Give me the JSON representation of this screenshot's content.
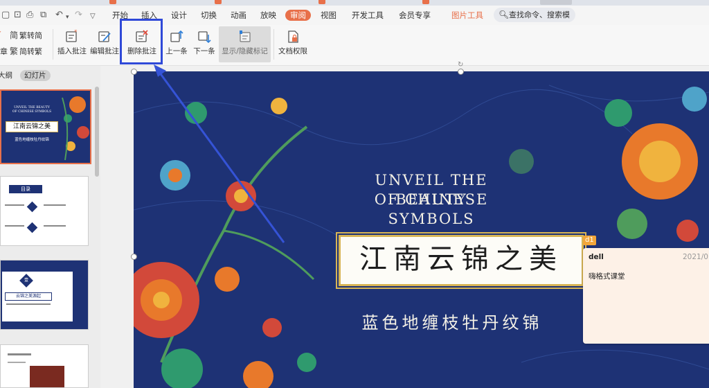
{
  "colors": {
    "accent": "#e8704a",
    "highlight": "#2f49d8",
    "slide_bg": "#1e3275",
    "gold": "#d8b554"
  },
  "quick_access": {
    "icons": [
      "save-icon",
      "print-preview-icon",
      "print-icon",
      "preview-icon",
      "undo-icon",
      "dropdown-arrow-icon",
      "redo-icon",
      "customize-icon"
    ]
  },
  "menu": {
    "items": [
      "开始",
      "插入",
      "设计",
      "切换",
      "动画",
      "放映",
      "审阅",
      "视图",
      "开发工具",
      "会员专享",
      "图片工具"
    ],
    "active": "审阅"
  },
  "search": {
    "text": "查找命令、搜索模板"
  },
  "ribbon": {
    "trad_to_simp": "繁转简",
    "simp_to_trad": "简转繁",
    "insert_comment": "插入批注",
    "edit_comment": "编辑批注",
    "delete_comment": "删除批注",
    "prev": "上一条",
    "next": "下一条",
    "show_hide_markup": "显示/隐藏标记",
    "doc_permissions": "文档权限"
  },
  "left_panel": {
    "tabs": [
      "大纲",
      "幻灯片"
    ],
    "selected_tab": "幻灯片",
    "thumb1": {
      "line1": "UNVEIL THE BEAUTY",
      "line2": "OF CHINESE SYMBOLS",
      "title": "江南云锦之美",
      "subtitle": "蓝色地缠枝牡丹纹锦"
    },
    "thumb2": {
      "header": "目录"
    },
    "thumb3": {
      "num": "壹",
      "title": "云锦之美源起"
    }
  },
  "slide": {
    "line1": "UNVEIL THE BEAUTY",
    "line2": "OF CHINESE SYMBOLS",
    "title": "江南云锦之美",
    "subtitle": "蓝色地缠枝牡丹纹锦"
  },
  "comment": {
    "marker": "d1",
    "author": "dell",
    "date": "2021/0",
    "text": "嗨格式课堂"
  }
}
